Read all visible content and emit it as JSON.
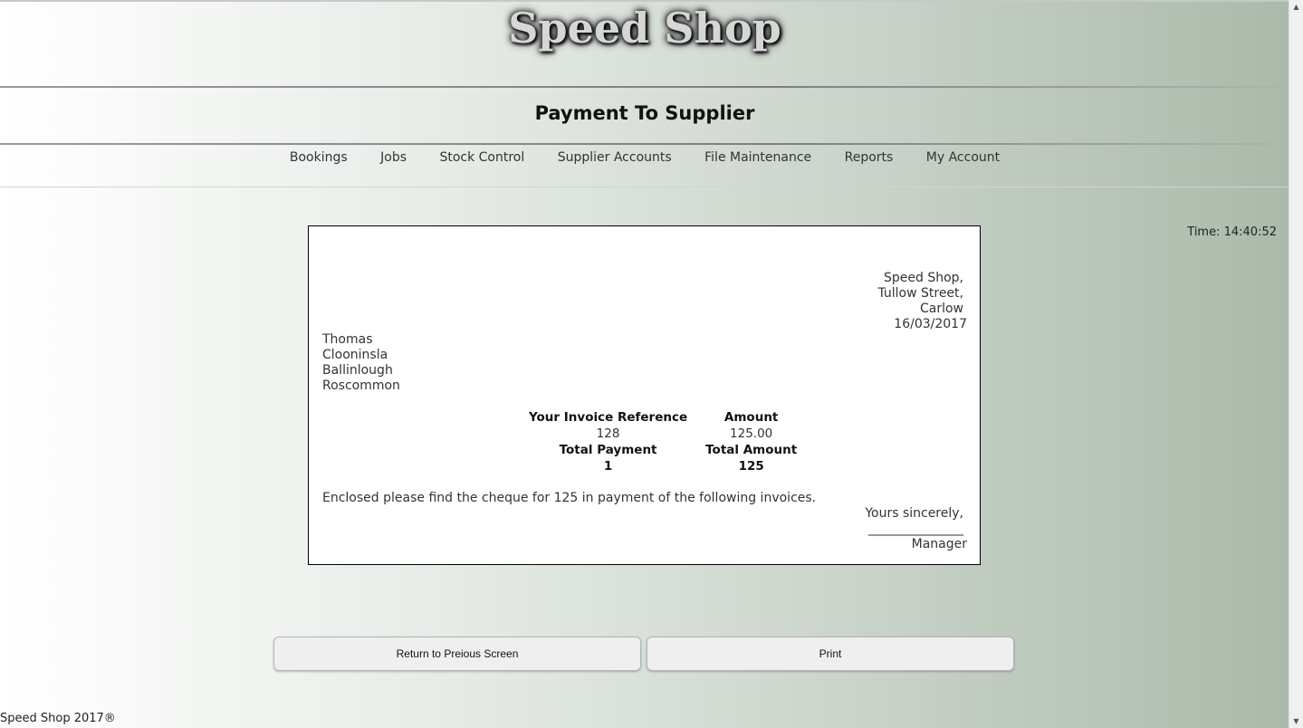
{
  "header": {
    "site_title": "Speed Shop",
    "page_title": "Payment To Supplier"
  },
  "nav": {
    "items": [
      "Bookings",
      "Jobs",
      "Stock Control",
      "Supplier Accounts",
      "File Maintenance",
      "Reports",
      "My Account"
    ]
  },
  "time_label": "Time: 14:40:52",
  "letter": {
    "from": {
      "line1": "Speed Shop,",
      "line2": "Tullow Street,",
      "line3": "Carlow",
      "date": "16/03/2017"
    },
    "to": {
      "line1": "Thomas",
      "line2": "Clooninsla",
      "line3": "Ballinlough",
      "line4": "Roscommon"
    },
    "table": {
      "col1_header": "Your Invoice Reference",
      "col2_header": "Amount",
      "row": {
        "ref": "128",
        "amount": "125.00"
      },
      "total_label1": "Total Payment",
      "total_label2": "Total Amount",
      "total_count": "1",
      "total_amount": "125"
    },
    "enclosed_text": "Enclosed please find the cheque for 125 in payment of the following invoices.",
    "closing": "Yours sincerely,",
    "signature_line": "_______________",
    "signatory": "Manager"
  },
  "buttons": {
    "return_label": "Return to Preious Screen",
    "print_label": "Print"
  },
  "footer": "Speed Shop 2017®",
  "scrollbar": {
    "up_icon": "▲",
    "down_icon": "▼"
  }
}
